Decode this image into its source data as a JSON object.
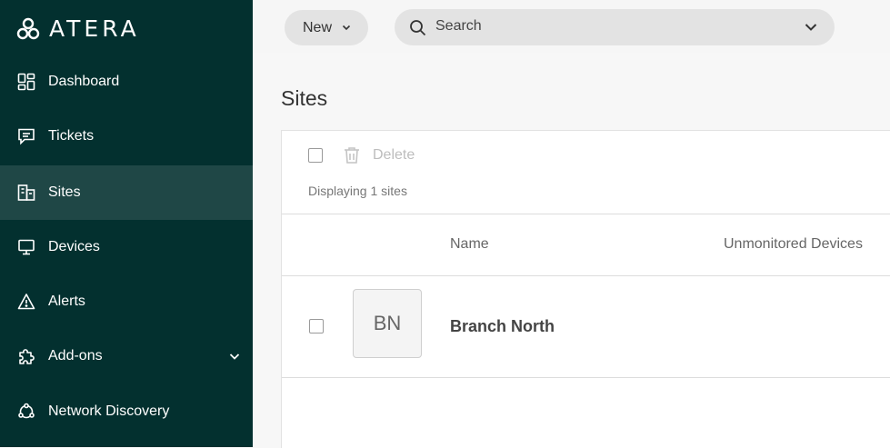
{
  "app": {
    "logo_text": "ATERA"
  },
  "sidebar": {
    "items": [
      {
        "label": "Dashboard",
        "icon": "dashboard-icon"
      },
      {
        "label": "Tickets",
        "icon": "ticket-icon"
      },
      {
        "label": "Sites",
        "icon": "building-icon",
        "active": true
      },
      {
        "label": "Devices",
        "icon": "monitor-icon"
      },
      {
        "label": "Alerts",
        "icon": "warning-icon"
      },
      {
        "label": "Add-ons",
        "icon": "puzzle-icon",
        "expandable": true
      },
      {
        "label": "Network Discovery",
        "icon": "network-icon"
      }
    ]
  },
  "topbar": {
    "new_label": "New",
    "search_placeholder": "Search"
  },
  "page": {
    "title": "Sites"
  },
  "toolbar": {
    "delete_label": "Delete",
    "displaying_text": "Displaying 1 sites"
  },
  "table": {
    "columns": [
      "Name",
      "Unmonitored Devices"
    ],
    "rows": [
      {
        "initials": "BN",
        "name": "Branch North"
      }
    ]
  },
  "colors": {
    "sidebar_bg": "#03302f",
    "sidebar_active": "#1f4746",
    "accent_bg": "#e3e3e3"
  }
}
